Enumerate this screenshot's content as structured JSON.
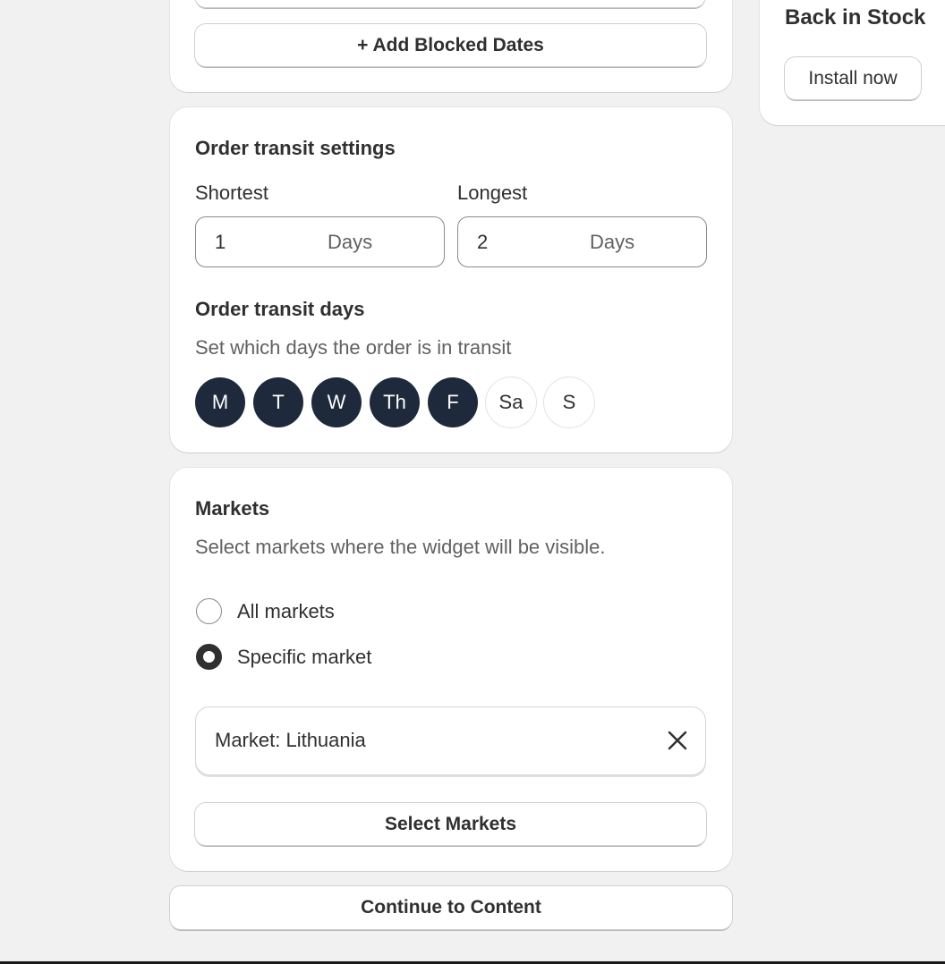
{
  "blocked_dates": {
    "add_button_label": "+ Add Blocked Dates"
  },
  "side_promo": {
    "title": "Back in Stock",
    "install_label": "Install now"
  },
  "transit_settings": {
    "title": "Order transit settings",
    "shortest": {
      "label": "Shortest",
      "value": "1",
      "suffix": "Days"
    },
    "longest": {
      "label": "Longest",
      "value": "2",
      "suffix": "Days"
    },
    "days_title": "Order transit days",
    "days_subtitle": "Set which days the order is in transit",
    "days": [
      {
        "label": "M",
        "selected": true
      },
      {
        "label": "T",
        "selected": true
      },
      {
        "label": "W",
        "selected": true
      },
      {
        "label": "Th",
        "selected": true
      },
      {
        "label": "F",
        "selected": true
      },
      {
        "label": "Sa",
        "selected": false
      },
      {
        "label": "S",
        "selected": false
      }
    ]
  },
  "markets": {
    "title": "Markets",
    "subtitle": "Select markets where the widget will be visible.",
    "options": [
      {
        "label": "All markets",
        "checked": false
      },
      {
        "label": "Specific market",
        "checked": true
      }
    ],
    "selected_tag": "Market: Lithuania",
    "select_button_label": "Select Markets"
  },
  "continue_button_label": "Continue to Content",
  "colors": {
    "background": "#f1f1f1",
    "day_selected": "#1e2a3b",
    "text": "#303030",
    "muted_text": "#616161"
  }
}
